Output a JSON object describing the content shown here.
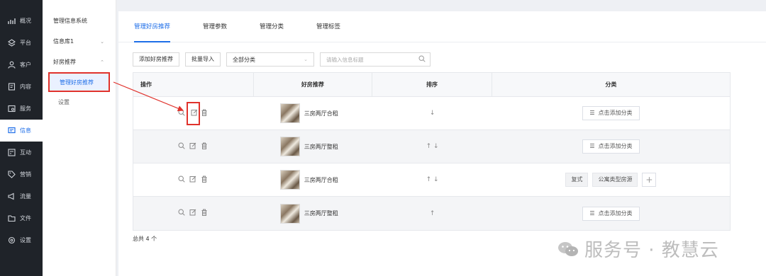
{
  "left_nav": [
    {
      "label": "概况",
      "icon": "chart-icon",
      "active": false
    },
    {
      "label": "平台",
      "icon": "layers-icon",
      "active": false
    },
    {
      "label": "客户",
      "icon": "user-icon",
      "active": false
    },
    {
      "label": "内容",
      "icon": "document-icon",
      "active": false
    },
    {
      "label": "服务",
      "icon": "service-icon",
      "active": false
    },
    {
      "label": "信息",
      "icon": "message-icon",
      "active": true
    },
    {
      "label": "互动",
      "icon": "interact-icon",
      "active": false
    },
    {
      "label": "营销",
      "icon": "tag-icon",
      "active": false
    },
    {
      "label": "流量",
      "icon": "megaphone-icon",
      "active": false
    },
    {
      "label": "文件",
      "icon": "folder-icon",
      "active": false
    },
    {
      "label": "设置",
      "icon": "gear-icon",
      "active": false
    }
  ],
  "sub_nav": {
    "title": "管理信息系统",
    "groups": [
      {
        "label": "信息库1",
        "chevron": "⌄"
      },
      {
        "label": "好房推荐",
        "chevron": "⌃"
      }
    ],
    "selected": "管理好房推荐",
    "child": "设置"
  },
  "tabs": [
    "管理好房推荐",
    "管理参数",
    "管理分类",
    "管理标签"
  ],
  "toolbar": {
    "add_label": "添加好房推荐",
    "import_label": "批量导入",
    "select_value": "全部分类",
    "search_placeholder": "请输入信息标题"
  },
  "table": {
    "headers": [
      "操作",
      "好房推荐",
      "排序",
      "分类"
    ],
    "rows": [
      {
        "title": "三房两厅合租",
        "sort": "↓",
        "category_button": "点击添加分类"
      },
      {
        "title": "三房两厅整租",
        "sort": "↑ ↓",
        "category_button": "点击添加分类"
      },
      {
        "title": "三房两厅合租",
        "sort": "↑ ↓",
        "tags": [
          "复式",
          "公寓类型房源"
        ]
      },
      {
        "title": "三房两厅整租",
        "sort": "↑",
        "category_button": "点击添加分类"
      }
    ]
  },
  "footer": {
    "total": "总共 4 个"
  },
  "watermark": "服务号 · 教慧云",
  "colors": {
    "accent": "#1e6ee8",
    "highlight": "#e0322c",
    "nav_bg": "#1f2329"
  }
}
